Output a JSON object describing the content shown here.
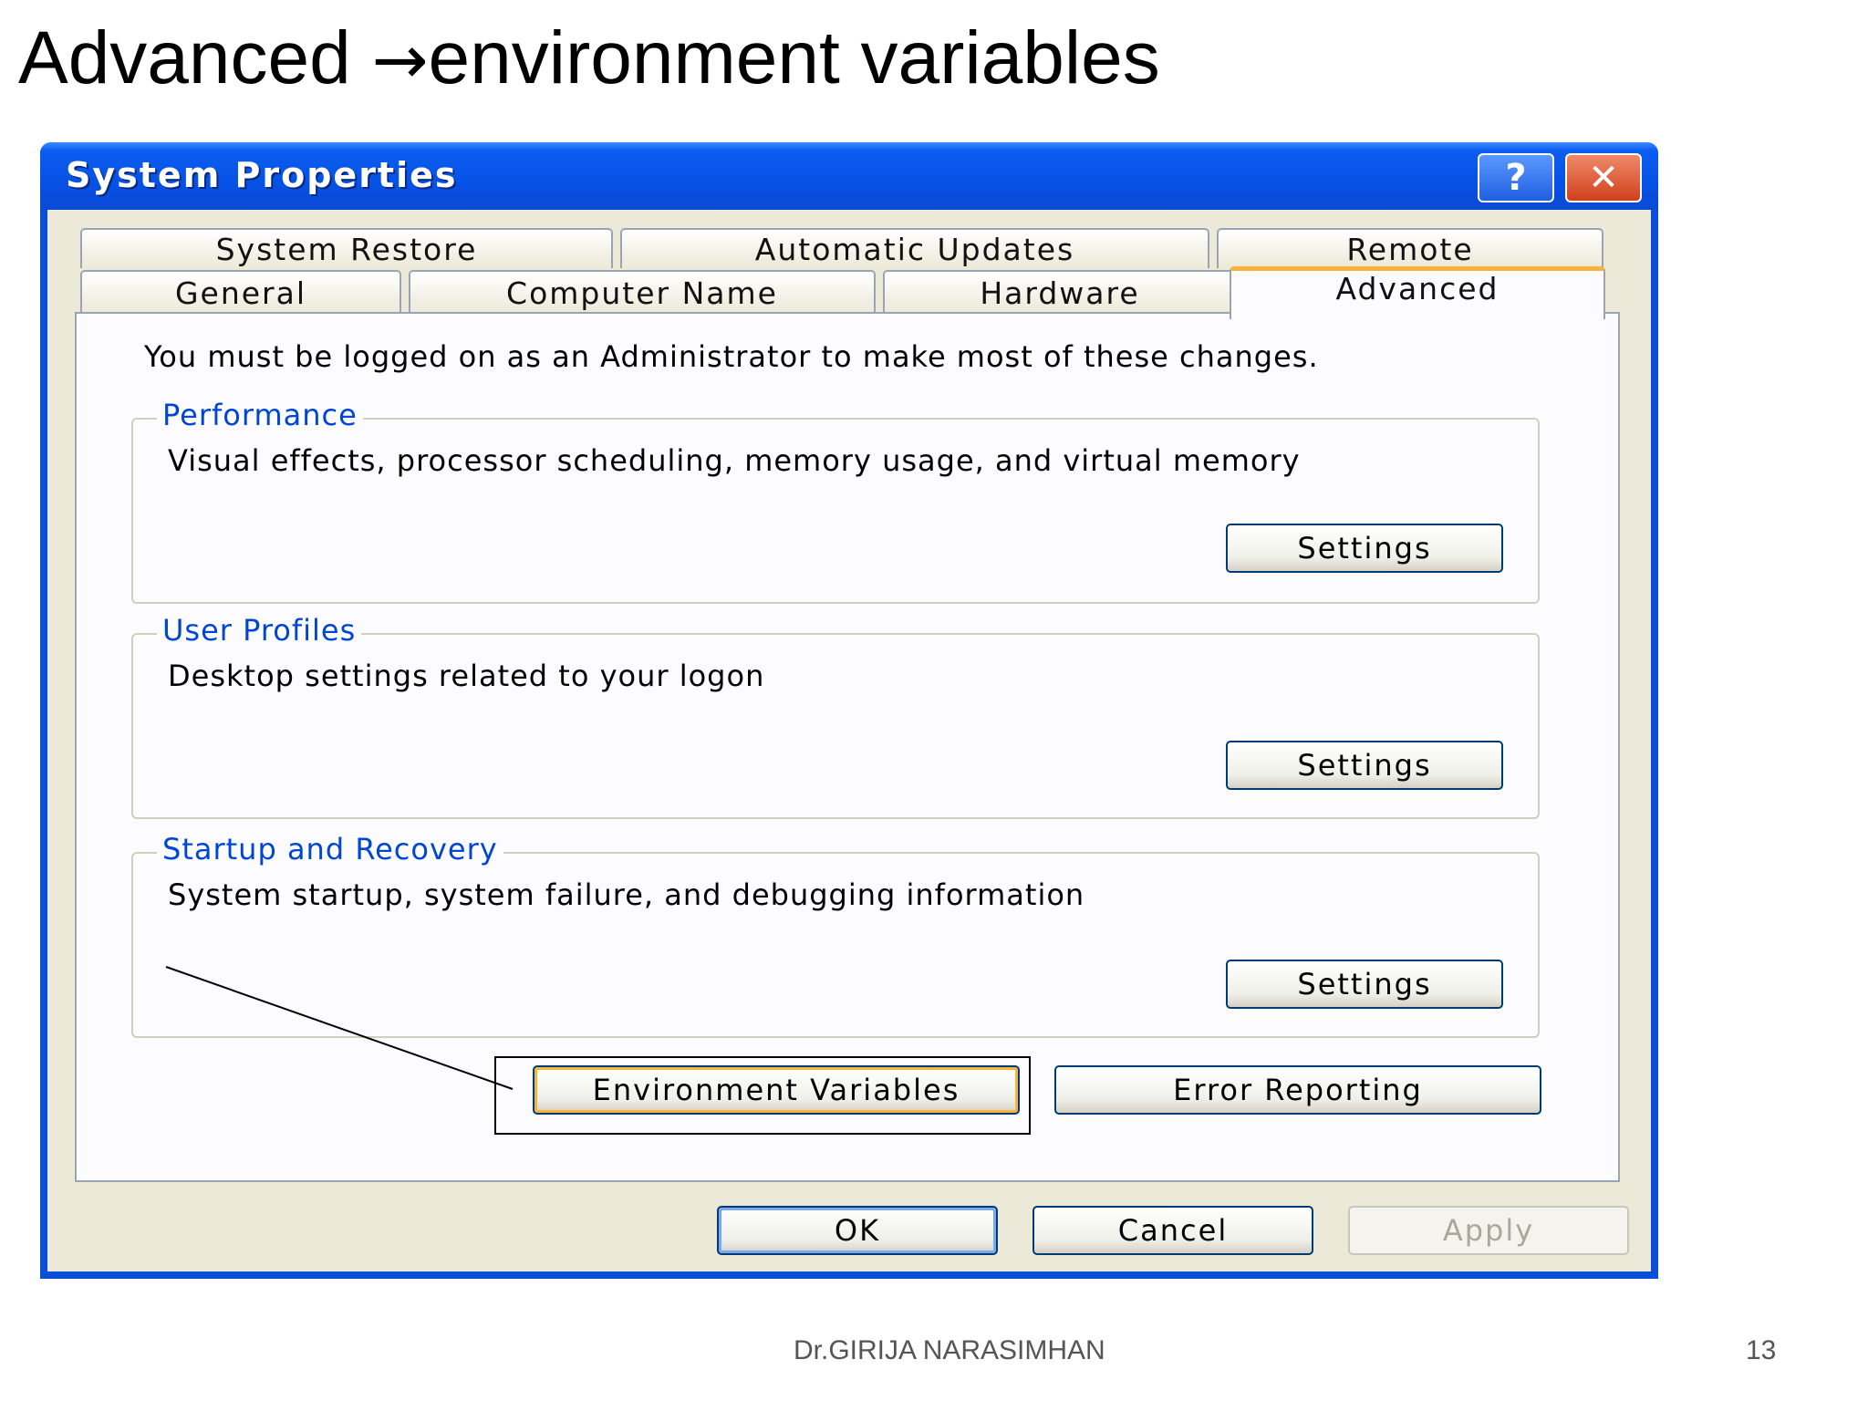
{
  "slide": {
    "title_left": "Advanced ",
    "title_arrow": "→",
    "title_right": "environment variables",
    "author": "Dr.GIRIJA NARASIMHAN",
    "page": "13"
  },
  "window": {
    "title": "System Properties",
    "help_label": "?",
    "close_label": "✕"
  },
  "tabs": {
    "row1": [
      "System Restore",
      "Automatic Updates",
      "Remote"
    ],
    "row2": [
      "General",
      "Computer Name",
      "Hardware",
      "Advanced"
    ],
    "active": "Advanced"
  },
  "advanced": {
    "note": "You must be logged on as an Administrator to make most of these changes.",
    "performance": {
      "label": "Performance",
      "desc": "Visual effects, processor scheduling, memory usage, and virtual memory",
      "button": "Settings"
    },
    "user_profiles": {
      "label": "User Profiles",
      "desc": "Desktop settings related to your logon",
      "button": "Settings"
    },
    "startup": {
      "label": "Startup and Recovery",
      "desc": "System startup, system failure, and debugging information",
      "button": "Settings"
    },
    "env_button": "Environment Variables",
    "error_button": "Error Reporting"
  },
  "dialog_buttons": {
    "ok": "OK",
    "cancel": "Cancel",
    "apply": "Apply"
  },
  "colors": {
    "titlebar": "#0651e6",
    "dialog_bg": "#ece9d8",
    "group_label": "#0046d5",
    "focus_ring": "#f8b33c"
  }
}
